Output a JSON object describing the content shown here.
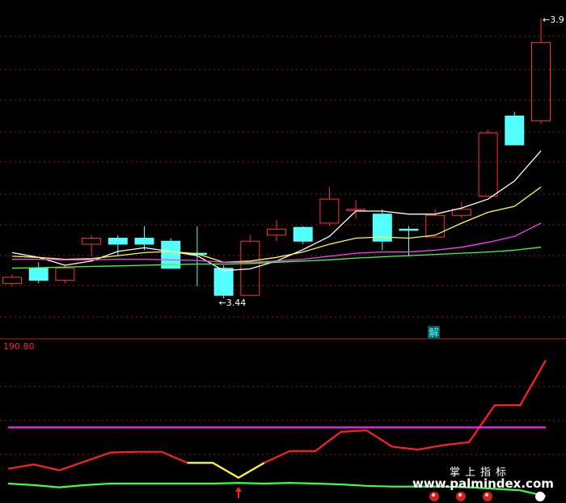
{
  "chart_data": [
    {
      "type": "candlestick",
      "name": "price-panel",
      "annotations": {
        "high_label": "3.9",
        "low_label": "3.44",
        "marker_text": "解"
      },
      "candles": [
        {
          "o": 3.46,
          "c": 3.47,
          "h": 3.475,
          "l": 3.455,
          "up": true
        },
        {
          "o": 3.485,
          "c": 3.465,
          "h": 3.495,
          "l": 3.46,
          "up": false
        },
        {
          "o": 3.465,
          "c": 3.485,
          "h": 3.49,
          "l": 3.46,
          "up": true
        },
        {
          "o": 3.525,
          "c": 3.535,
          "h": 3.54,
          "l": 3.505,
          "up": true
        },
        {
          "o": 3.535,
          "c": 3.525,
          "h": 3.54,
          "l": 3.505,
          "up": false
        },
        {
          "o": 3.535,
          "c": 3.525,
          "h": 3.555,
          "l": 3.515,
          "up": false
        },
        {
          "o": 3.53,
          "c": 3.485,
          "h": 3.535,
          "l": 3.485,
          "up": false
        },
        {
          "o": 3.51,
          "c": 3.508,
          "h": 3.555,
          "l": 3.455,
          "up": false
        },
        {
          "o": 3.485,
          "c": 3.44,
          "h": 3.49,
          "l": 3.435,
          "up": false
        },
        {
          "o": 3.44,
          "c": 3.53,
          "h": 3.54,
          "l": 3.44,
          "up": true
        },
        {
          "o": 3.54,
          "c": 3.55,
          "h": 3.565,
          "l": 3.53,
          "up": true
        },
        {
          "o": 3.553,
          "c": 3.53,
          "h": 3.555,
          "l": 3.525,
          "up": false
        },
        {
          "o": 3.56,
          "c": 3.6,
          "h": 3.62,
          "l": 3.555,
          "up": true
        },
        {
          "o": 3.583,
          "c": 3.583,
          "h": 3.598,
          "l": 3.568,
          "up": true
        },
        {
          "o": 3.575,
          "c": 3.53,
          "h": 3.583,
          "l": 3.515,
          "up": false
        },
        {
          "o": 3.55,
          "c": 3.55,
          "h": 3.555,
          "l": 3.505,
          "up": false
        },
        {
          "o": 3.537,
          "c": 3.573,
          "h": 3.583,
          "l": 3.537,
          "up": true
        },
        {
          "o": 3.573,
          "c": 3.583,
          "h": 3.595,
          "l": 3.568,
          "up": true
        },
        {
          "o": 3.605,
          "c": 3.71,
          "h": 3.715,
          "l": 3.605,
          "up": true
        },
        {
          "o": 3.69,
          "c": 3.738,
          "h": 3.745,
          "l": 3.69,
          "up": false
        },
        {
          "o": 3.73,
          "c": 3.86,
          "h": 3.9,
          "l": 3.725,
          "up": true
        }
      ],
      "series": [
        {
          "color": "#ffffff",
          "values": [
            3.511,
            3.503,
            3.49,
            3.497,
            3.513,
            3.519,
            3.513,
            3.506,
            3.481,
            3.484,
            3.497,
            3.516,
            3.538,
            3.58,
            3.58,
            3.575,
            3.575,
            3.585,
            3.6,
            3.63,
            3.68
          ]
        },
        {
          "color": "#ffff40",
          "values": [
            3.505,
            3.503,
            3.5,
            3.501,
            3.506,
            3.511,
            3.513,
            3.509,
            3.495,
            3.497,
            3.503,
            3.512,
            3.525,
            3.535,
            3.537,
            3.535,
            3.54,
            3.56,
            3.578,
            3.588,
            3.62
          ]
        },
        {
          "color": "#ff40ff",
          "values": [
            3.5,
            3.5,
            3.499,
            3.499,
            3.5,
            3.5,
            3.499,
            3.498,
            3.495,
            3.495,
            3.497,
            3.5,
            3.505,
            3.51,
            3.512,
            3.512,
            3.515,
            3.52,
            3.528,
            3.538,
            3.56
          ]
        },
        {
          "color": "#40ff40",
          "values": [
            3.485,
            3.486,
            3.487,
            3.488,
            3.489,
            3.49,
            3.491,
            3.492,
            3.492,
            3.493,
            3.495,
            3.497,
            3.499,
            3.502,
            3.504,
            3.506,
            3.508,
            3.51,
            3.512,
            3.515,
            3.52
          ]
        }
      ],
      "grid": true
    },
    {
      "type": "line",
      "name": "indicator-panel",
      "top_label": "190.80",
      "series": [
        {
          "color": "#ff2020",
          "values": [
            44,
            50,
            42,
            54,
            66,
            67,
            67,
            52,
            52,
            32,
            52,
            68,
            68,
            94,
            96,
            74,
            70,
            76,
            80,
            130,
            130,
            190.8
          ]
        },
        {
          "color": "#40ff40",
          "values": [
            24,
            22,
            19,
            22,
            24,
            24,
            24,
            24,
            24,
            25,
            24,
            25,
            24,
            23,
            21,
            20,
            20,
            20,
            19,
            17,
            15,
            7
          ]
        },
        {
          "color": "#ff20ff",
          "values": [
            100,
            100,
            100,
            100,
            100,
            100,
            100,
            100,
            100,
            100,
            100,
            100,
            100,
            100,
            100,
            100,
            100,
            100,
            100,
            100,
            100,
            100
          ]
        }
      ],
      "highlight_segment": {
        "color": "#ffff30",
        "from": 7,
        "to": 10
      },
      "signal_marker": {
        "index": 9,
        "color": "#ff2020"
      },
      "grid": true
    }
  ],
  "watermark": {
    "title": "掌上指标",
    "url": "www.palmindex.com"
  }
}
